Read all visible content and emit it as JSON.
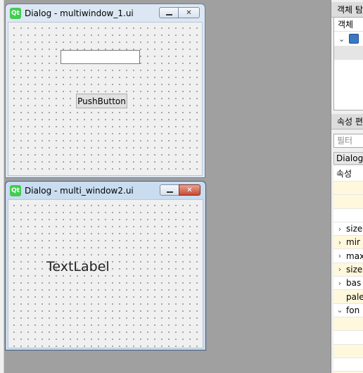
{
  "windows": [
    {
      "title": "Dialog - multiwindow_1.ui",
      "logo": "Qt",
      "minimize_glyph": "",
      "close_glyph": "✕",
      "button_label": "PushButton",
      "line_edit_value": ""
    },
    {
      "title": "Dialog - multi_window2.ui",
      "logo": "Qt",
      "close_glyph": "✕",
      "text_label": "TextLabel"
    }
  ],
  "object_inspector": {
    "header": "객체 탐",
    "column_header": "객체",
    "tree_expand_icon": "chevron-down-icon",
    "tree_item_icon": "dialog-form-icon"
  },
  "property_editor": {
    "header": "속성 편",
    "filter_placeholder": "필터",
    "class_name": "Dialog",
    "column_header": "속성",
    "rows": [
      {
        "expander": "",
        "name": "",
        "bg": "yellow"
      },
      {
        "expander": "",
        "name": "",
        "bg": "yellow"
      },
      {
        "expander": "",
        "name": "",
        "bg": "white"
      },
      {
        "expander": "›",
        "name": "size",
        "bg": "white"
      },
      {
        "expander": "›",
        "name": "mir",
        "bg": "yellow"
      },
      {
        "expander": "›",
        "name": "max",
        "bg": "white"
      },
      {
        "expander": "›",
        "name": "size",
        "bg": "yellow"
      },
      {
        "expander": "›",
        "name": "bas",
        "bg": "white"
      },
      {
        "expander": "",
        "name": "pale",
        "bg": "yellow"
      },
      {
        "expander": "⌄",
        "name": "fon",
        "bg": "white"
      },
      {
        "expander": "",
        "name": "",
        "bg": "yellow"
      },
      {
        "expander": "",
        "name": "",
        "bg": "white"
      },
      {
        "expander": "",
        "name": "",
        "bg": "yellow"
      },
      {
        "expander": "",
        "name": "",
        "bg": "white"
      },
      {
        "expander": "",
        "name": "",
        "bg": "yellow"
      }
    ]
  },
  "colors": {
    "row_yellow": "#fff8dc",
    "row_white": "#ffffff",
    "qt_green": "#41cd52",
    "close_red": "#c74a31"
  }
}
